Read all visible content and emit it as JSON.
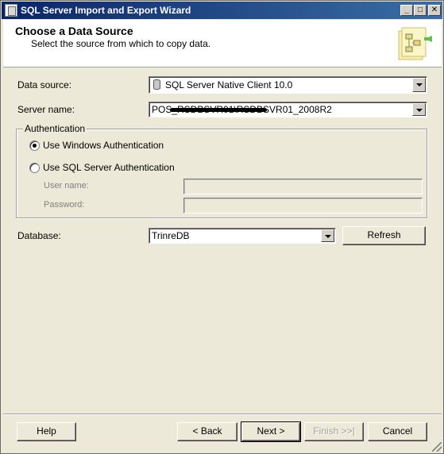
{
  "window": {
    "title": "SQL Server Import and Export Wizard",
    "minimize_label": "_",
    "maximize_label": "□",
    "close_label": "✕"
  },
  "header": {
    "title": "Choose a Data Source",
    "subtitle": "Select the source from which to copy data."
  },
  "form": {
    "data_source_label": "Data source:",
    "data_source_value": "SQL Server Native Client 10.0",
    "server_name_label": "Server name:",
    "server_name_value": "POS_RSDBSVR01\\RSDBSVR01_2008R2",
    "authentication_legend": "Authentication",
    "auth_windows_label": "Use Windows Authentication",
    "auth_sql_label": "Use SQL Server Authentication",
    "auth_selected": "windows",
    "user_name_label": "User name:",
    "password_label": "Password:",
    "database_label": "Database:",
    "database_value": "TrinreDB",
    "refresh_label": "Refresh"
  },
  "footer": {
    "help_label": "Help",
    "back_label": "< Back",
    "next_label": "Next >",
    "finish_label": "Finish >>|",
    "cancel_label": "Cancel"
  },
  "colors": {
    "titlebar_start": "#0a246a",
    "titlebar_end": "#3a6ea5",
    "dialog_bg": "#ece9d8"
  }
}
